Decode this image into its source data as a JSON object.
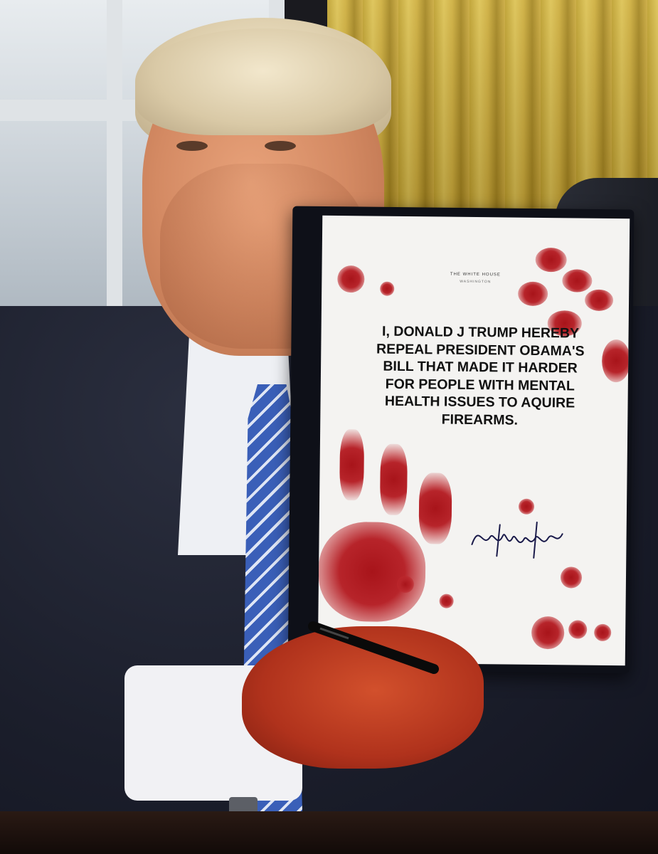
{
  "document": {
    "header_line_1": "THE WHITE HOUSE",
    "header_line_2": "WASHINGTON",
    "statement_lines": [
      "I, DONALD J TRUMP HEREBY",
      "REPEAL PRESIDENT OBAMA'S",
      "BILL THAT MADE IT HARDER",
      "FOR PEOPLE WITH MENTAL",
      "HEALTH ISSUES TO AQUIRE",
      "FIREARMS."
    ],
    "signature_icon": "handwritten-signature",
    "blood_color": "#a8141a"
  },
  "scene": {
    "curtain_color": "#c9a93a",
    "suit_color": "#1b1e2b",
    "tie_color": "#3a5fb8"
  }
}
